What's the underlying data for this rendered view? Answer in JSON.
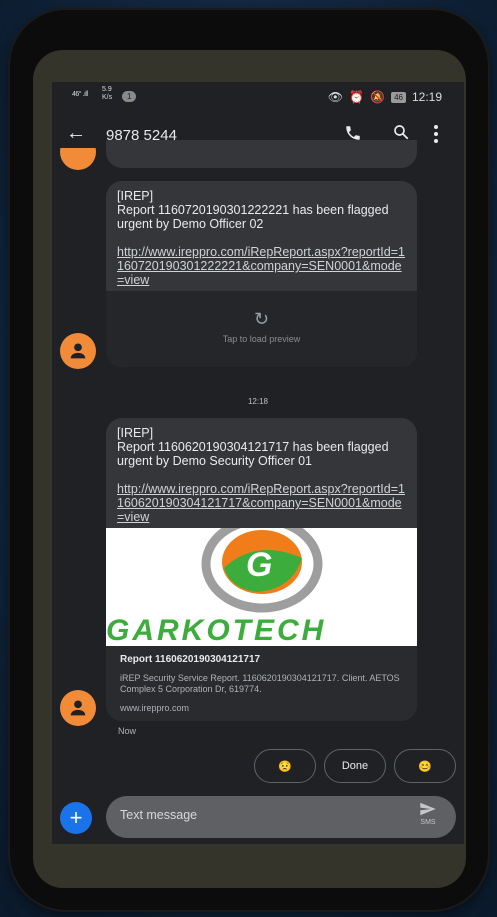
{
  "status_bar": {
    "signal": "46° .ıll",
    "speed_value": "5.9",
    "speed_unit": "K/s",
    "notification_count": "1",
    "battery": "46",
    "time": "12:19"
  },
  "app_bar": {
    "title": "9878 5244",
    "icons": [
      "back-arrow-icon",
      "phone-icon",
      "search-icon",
      "more-vert-icon"
    ]
  },
  "messages": [
    {
      "header": "[IREP]",
      "body": "Report 1160720190301222221 has been flagged urgent by Demo Officer 02",
      "link": "http://www.ireppro.com/iRepReport.aspx?reportId=1160720190301222221&company=SEN0001&mode=view",
      "preview_action": "Tap to load preview"
    },
    {
      "header": "[IREP]",
      "body": "Report 1160620190304121717 has been flagged urgent by Demo Security Officer 01",
      "link": "http://www.ireppro.com/iRepReport.aspx?reportId=1160620190304121717&company=SEN0001&mode=view",
      "preview_logo_text": "GARKOTECH",
      "preview_title": "Report 1160620190304121717",
      "preview_description": "iREP Security Service Report. 1160620190304121717. Client. AETOS Complex 5 Corporation Dr, 619774.",
      "preview_host": "www.ireppro.com"
    }
  ],
  "timestamp_divider": "12:18",
  "last_message_time": "Now",
  "smart_replies": [
    "😟",
    "Done",
    "😊"
  ],
  "composer": {
    "placeholder": "Text message",
    "send_label": "SMS"
  },
  "colors": {
    "screen_bg": "#202124",
    "bubble_bg": "#35363a",
    "avatar": "#f28b38",
    "fab": "#1a73e8",
    "logo_orange": "#f07d1a",
    "logo_green": "#3cad3c"
  }
}
